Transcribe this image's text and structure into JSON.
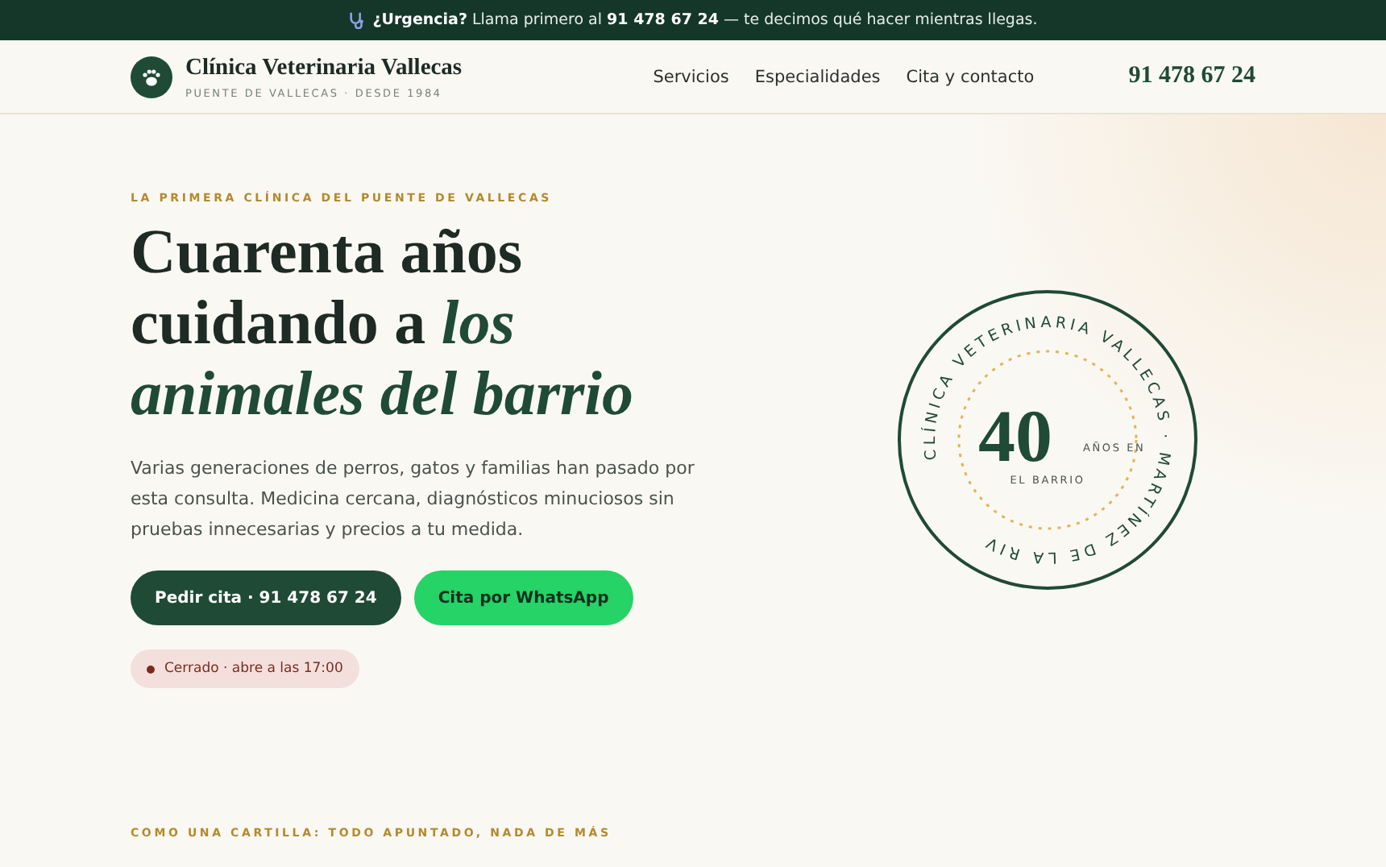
{
  "alert_bar": {
    "text": "**¿Urgencia?** Llama primero al **91 478 67 24** — te decimos qué hacer mientras llegas."
  },
  "header": {
    "brand": "Clínica Veterinaria Vallecas",
    "tagline": "PUENTE DE VALLECAS · DESDE 1984",
    "nav": [
      {
        "label": "Servicios"
      },
      {
        "label": "Especialidades"
      },
      {
        "label": "Cita y contacto"
      }
    ],
    "phone": "91 478 67 24"
  },
  "hero": {
    "eyebrow": "LA PRIMERA CLÍNICA DEL PUENTE DE VALLECAS",
    "title": "Cuarenta años cuidando a *los animales del barrio*",
    "lead": "Varias generaciones de perros, gatos y familias han pasado por esta consulta. Medicina cercana, diagnósticos minuciosos sin pruebas innecesarias y precios a tu medida.",
    "buttons": [
      {
        "label": "Pedir cita · 91 478 67 24",
        "kind": "primary"
      },
      {
        "label": "Cita por WhatsApp",
        "kind": "whatsapp"
      }
    ],
    "status": {
      "text": "Cerrado · abre a las 17:00",
      "open": false
    }
  },
  "seal": {
    "ring_text": "CLÍNICA VETERINARIA VALLECAS · MARTÍNEZ DE LA RIV",
    "number": "40",
    "caption_1": "AÑOS EN",
    "caption_2": "EL BARRIO"
  },
  "next_section": {
    "eyebrow": "COMO UNA CARTILLA: TODO APUNTADO, NADA DE MÁS"
  }
}
